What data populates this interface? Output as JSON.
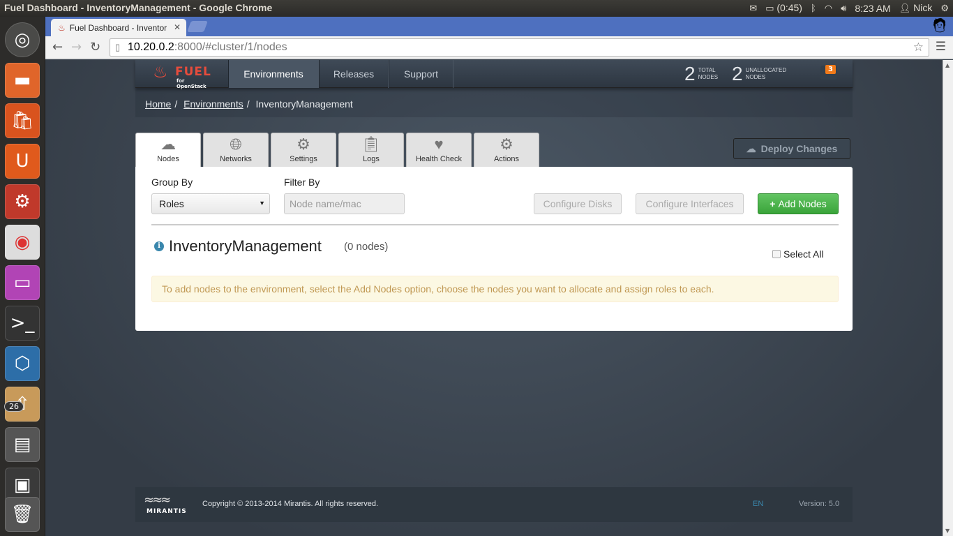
{
  "os": {
    "window_title": "Fuel Dashboard - InventoryManagement - Google Chrome",
    "battery": "(0:45)",
    "time": "8:23 AM",
    "user": "Nick",
    "launcher_badge": "26"
  },
  "browser": {
    "tab_title": "Fuel Dashboard - Inventor",
    "url_host": "10.20.0.2",
    "url_rest": ":8000/#cluster/1/nodes"
  },
  "navbar": {
    "logo_word": "FUEL",
    "logo_sub": "for OpenStack",
    "items": [
      {
        "label": "Environments",
        "active": true
      },
      {
        "label": "Releases",
        "active": false
      },
      {
        "label": "Support",
        "active": false
      }
    ],
    "total_nodes": "2",
    "total_label_1": "TOTAL",
    "total_label_2": "NODES",
    "unallocated_nodes": "2",
    "unallocated_label_1": "UNALLOCATED",
    "unallocated_label_2": "NODES",
    "notifications": "3"
  },
  "breadcrumbs": {
    "home": "Home",
    "environments": "Environments",
    "current": "InventoryManagement"
  },
  "tabs": [
    {
      "label": "Nodes",
      "icon": "cloud-icon"
    },
    {
      "label": "Networks",
      "icon": "network-icon"
    },
    {
      "label": "Settings",
      "icon": "gear-icon"
    },
    {
      "label": "Logs",
      "icon": "clipboard-icon"
    },
    {
      "label": "Health Check",
      "icon": "heart-icon"
    },
    {
      "label": "Actions",
      "icon": "gears-icon"
    }
  ],
  "deploy_label": "Deploy Changes",
  "panel": {
    "group_by_label": "Group By",
    "group_by_value": "Roles",
    "filter_by_label": "Filter By",
    "filter_placeholder": "Node name/mac",
    "configure_disks": "Configure Disks",
    "configure_interfaces": "Configure Interfaces",
    "add_nodes": "Add Nodes",
    "env_name": "InventoryManagement",
    "env_count": "(0 nodes)",
    "select_all": "Select All",
    "alert": "To add nodes to the environment, select the Add Nodes option, choose the nodes you want to allocate and assign roles to each."
  },
  "footer": {
    "brand": "MIRANTIS",
    "copyright": "Copyright © 2013-2014 Mirantis. All rights reserved.",
    "lang": "EN",
    "version": "Version: 5.0"
  }
}
